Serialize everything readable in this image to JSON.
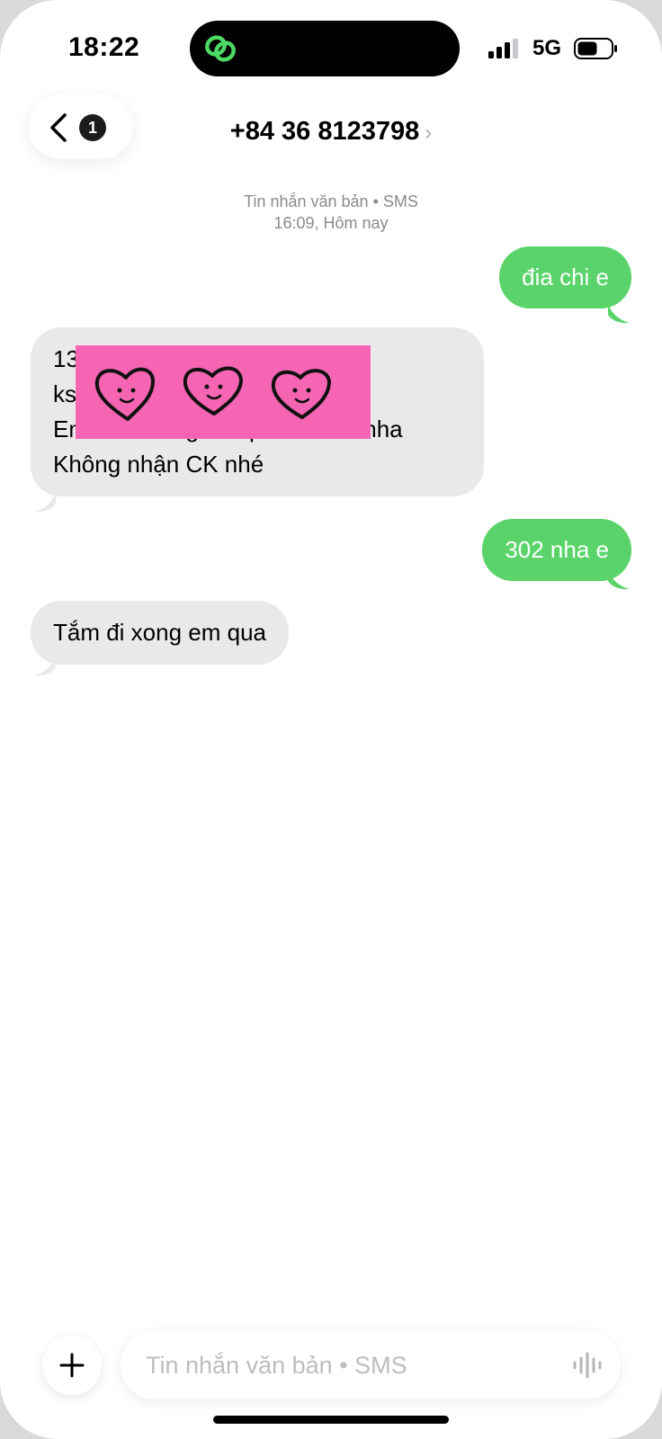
{
  "status": {
    "time": "18:22",
    "network": "5G",
    "icons": [
      "link-icon",
      "signal-icon",
      "battery-icon"
    ]
  },
  "nav": {
    "back_badge": "1",
    "contact": "+84 36 8123798",
    "contact_chevron": "›"
  },
  "thread": {
    "meta_line1": "Tin nhắn văn bản • SMS",
    "meta_line2": "16:09, Hôm nay",
    "messages": [
      {
        "side": "out",
        "text": "đia chi e"
      },
      {
        "side": "in",
        "lines": [
          "13 … Phú ,Q9",
          "ks",
          "Em từ chối người qua 30 tuổi nha",
          "Không nhận CK nhé"
        ]
      },
      {
        "side": "out",
        "text": "302 nha e"
      },
      {
        "side": "in",
        "text": "Tắm đi xong em qua"
      }
    ]
  },
  "composer": {
    "placeholder": "Tin nhắn văn bản • SMS",
    "value": ""
  },
  "colors": {
    "outgoing": "#5ad46a",
    "incoming": "#e9e9eb",
    "redaction": "#f665b3"
  }
}
